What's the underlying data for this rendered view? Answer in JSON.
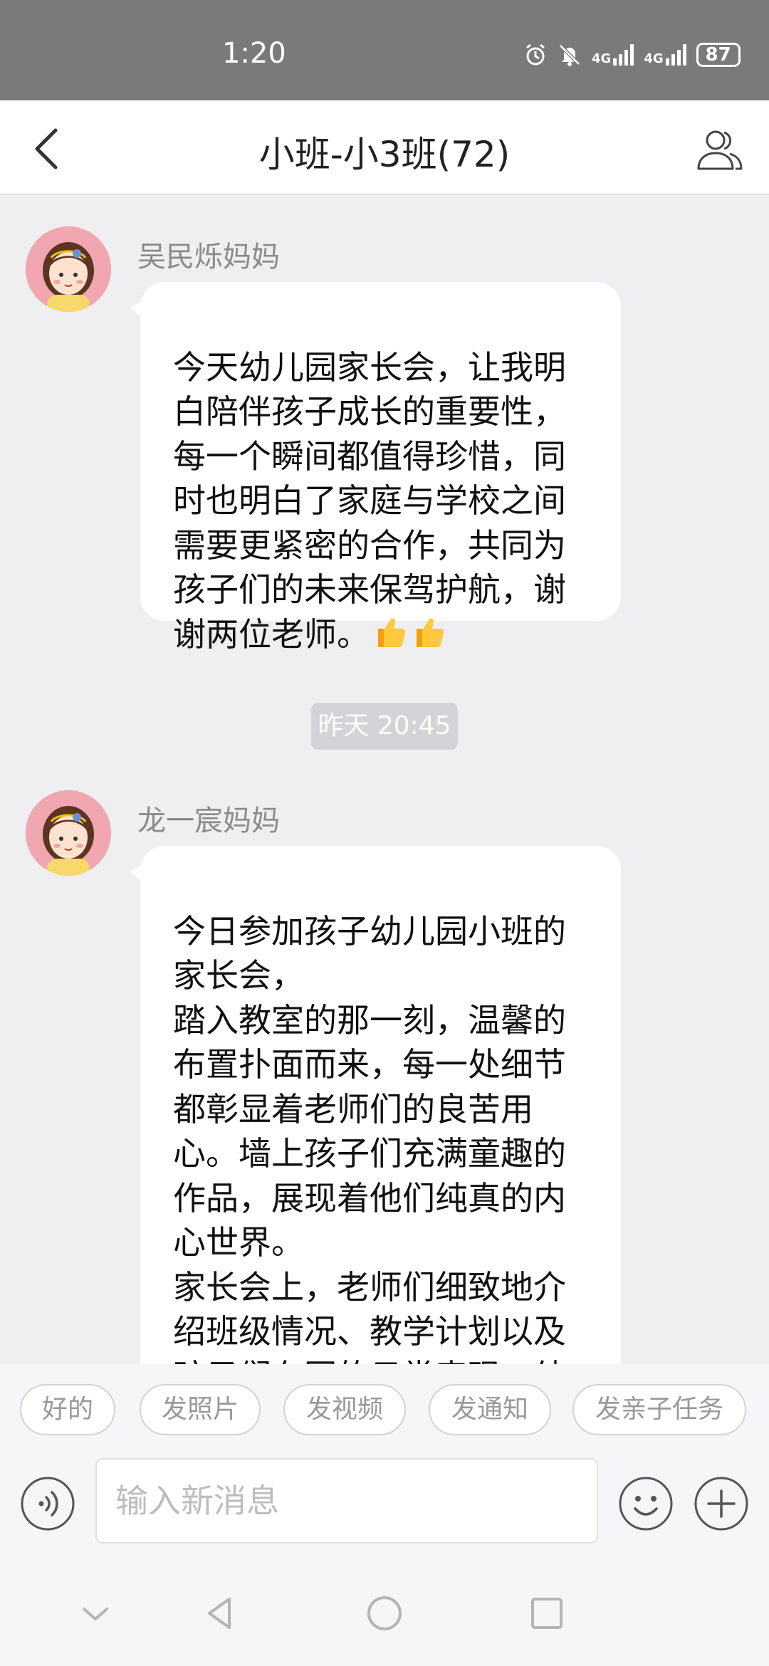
{
  "status_bar": {
    "time": "1:20",
    "network_1": "4G",
    "network_2": "4G",
    "battery": "87"
  },
  "header": {
    "title": "小班-小3班(72)"
  },
  "messages": [
    {
      "sender": "吴民烁妈妈",
      "text": "今天幼儿园家长会，让我明\n白陪伴孩子成长的重要性，\n每一个瞬间都值得珍惜，同\n时也明白了家庭与学校之间\n需要更紧密的合作，共同为\n孩子们的未来保驾护航，谢\n谢两位老师。",
      "emoji": [
        "thumbs-up-icon",
        "thumbs-up-icon"
      ]
    },
    {
      "sender": "龙一宸妈妈",
      "text": "今日参加孩子幼儿园小班的\n家长会，\n踏入教室的那一刻，温馨的\n布置扑面而来，每一处细节\n都彰显着老师们的良苦用\n心。墙上孩子们充满童趣的\n作品，展现着他们纯真的内\n心世界。\n家长会上，老师们细致地介\n绍班级情况、教学计划以及\n孩子们在园的日常表现。幼"
    }
  ],
  "time_divider": "昨天 20:45",
  "quick_replies": [
    "好的",
    "发照片",
    "发视频",
    "发通知",
    "发亲子任务"
  ],
  "input": {
    "placeholder": "输入新消息"
  },
  "icons": {
    "back": "back-chevron-icon",
    "members": "group-members-icon",
    "voice": "voice-icon",
    "emoji": "emoji-icon",
    "plus": "plus-icon"
  },
  "colors": {
    "status_bar": "#7a7a7a",
    "background": "#efeff2",
    "bubble": "#ffffff",
    "time_chip": "#d4d4d8"
  }
}
